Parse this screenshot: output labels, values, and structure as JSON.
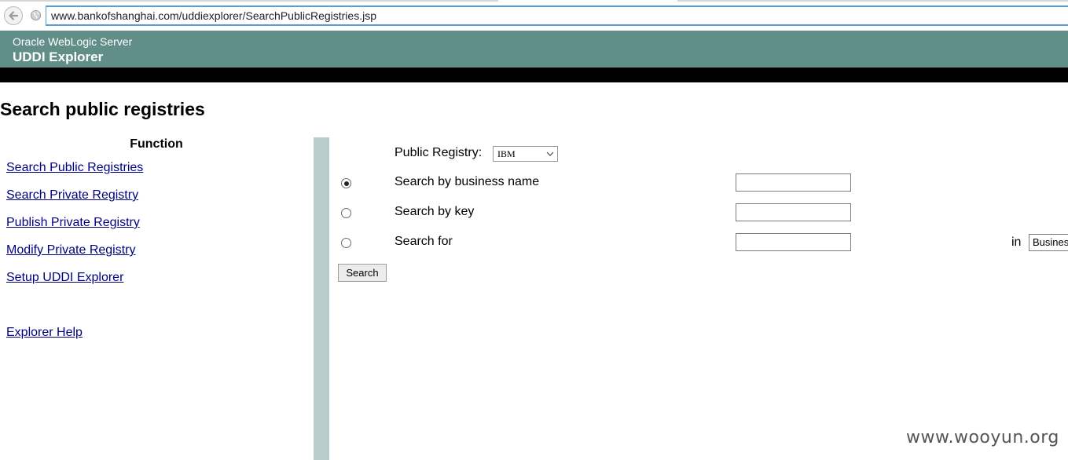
{
  "browser": {
    "url": "www.bankofshanghai.com/uddiexplorer/SearchPublicRegistries.jsp"
  },
  "header": {
    "product": "Oracle WebLogic Server",
    "app_title": "UDDI Explorer"
  },
  "page_title": "Search public registries",
  "sidebar": {
    "heading": "Function",
    "links": [
      {
        "label": "Search Public Registries"
      },
      {
        "label": "Search Private Registry"
      },
      {
        "label": "Publish Private Registry"
      },
      {
        "label": "Modify Private Registry"
      },
      {
        "label": "Setup UDDI Explorer"
      },
      {
        "label": "Explorer Help"
      }
    ]
  },
  "form": {
    "registry_label": "Public Registry:",
    "registry_selected": "IBM",
    "options": [
      {
        "label": "Search by business name",
        "selected": true,
        "value": ""
      },
      {
        "label": "Search by key",
        "selected": false,
        "value": ""
      },
      {
        "label": "Search for",
        "selected": false,
        "value": ""
      }
    ],
    "in_label": "in",
    "in_selected": "Business",
    "search_button": "Search"
  },
  "watermark": "www.wooyun.org",
  "colors": {
    "header_bg": "#628e8a",
    "divider": "#b8ccce",
    "link": "#000080"
  }
}
